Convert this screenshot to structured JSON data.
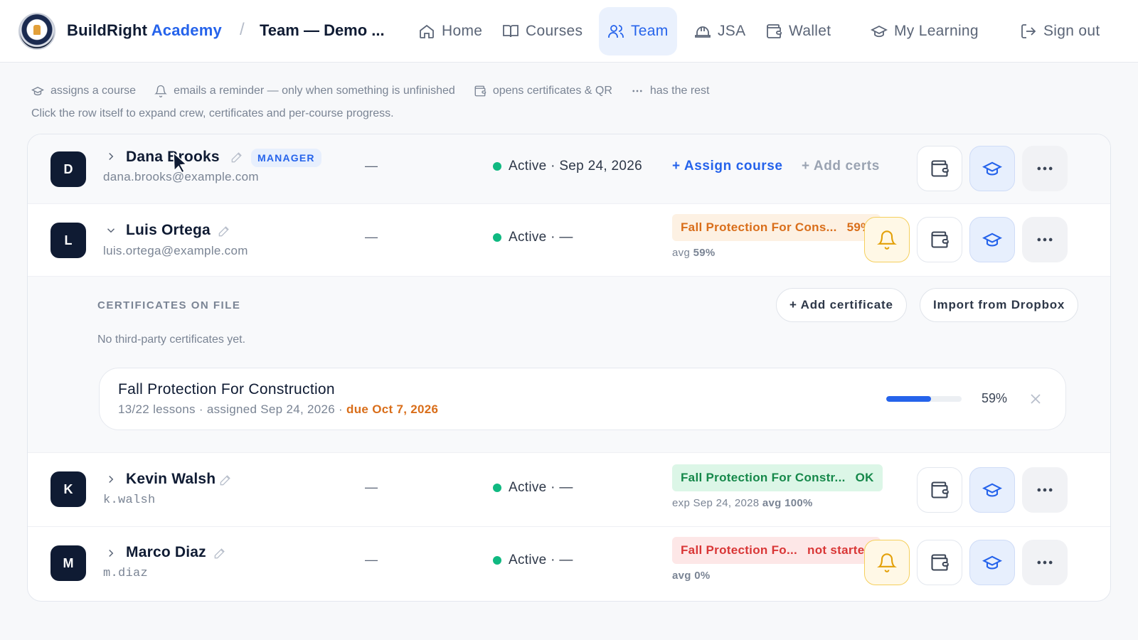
{
  "header": {
    "brand_main": "BuildRight",
    "brand_accent": "Academy",
    "breadcrumb_sep": "/",
    "breadcrumb": "Team — Demo ...",
    "nav": [
      {
        "label": "Home",
        "icon": "home-icon"
      },
      {
        "label": "Courses",
        "icon": "book-icon"
      },
      {
        "label": "Team",
        "icon": "users-icon",
        "active": true
      },
      {
        "label": "JSA",
        "icon": "hardhat-icon"
      },
      {
        "label": "Wallet",
        "icon": "wallet-icon"
      },
      {
        "label": "My Learning",
        "icon": "graduation-cap-icon"
      },
      {
        "label": "Sign out",
        "icon": "sign-out-icon"
      }
    ]
  },
  "hints": {
    "assign": "assigns a course",
    "remind": "emails a reminder — only when something is unfinished",
    "certs": "opens certificates & QR",
    "more": "has the rest",
    "sub": "Click the row itself to expand crew, certificates and per-course progress."
  },
  "members": [
    {
      "initial": "D",
      "name": "Dana Brooks",
      "role_badge": "MANAGER",
      "email": "dana.brooks@example.com",
      "dash": "—",
      "status": "Active · Sep 24, 2026",
      "assign_label": "+ Assign course",
      "addcerts_label": "+ Add certs"
    },
    {
      "initial": "L",
      "name": "Luis Ortega",
      "email": "luis.ortega@example.com",
      "dash": "—",
      "status": "Active · —",
      "course_pill": "Fall Protection For Cons...",
      "course_pill_value": "59%",
      "subline_prefix": "avg",
      "subline_value": "59%",
      "expanded": {
        "cert_heading": "CERTIFICATES ON FILE",
        "add_certificate": "+ Add certificate",
        "import_dropbox": "Import from Dropbox",
        "no_certs": "No third-party certificates yet.",
        "course": {
          "title": "Fall Protection For Construction",
          "meta": "13/22 lessons · assigned Sep 24, 2026 · ",
          "due": "due Oct 7, 2026",
          "progress": 0.59,
          "progress_label": "59%"
        }
      }
    },
    {
      "initial": "K",
      "name": "Kevin Walsh",
      "email": "k.walsh",
      "dash": "—",
      "status": "Active · —",
      "course_pill": "Fall Protection For Constr...",
      "course_pill_value": "OK",
      "subline_exp": "exp Sep 24, 2028",
      "subline_prefix": "avg",
      "subline_value": "100%"
    },
    {
      "initial": "M",
      "name": "Marco Diaz",
      "email": "m.diaz",
      "dash": "—",
      "status": "Active · —",
      "course_pill": "Fall Protection Fo...",
      "course_pill_value": "not started",
      "subline_prefix": "avg",
      "subline_value": "0%"
    }
  ],
  "colors": {
    "accent": "#2563eb",
    "navy": "#0f1b33",
    "status_active": "#10b981",
    "warn": "#d96e1a",
    "ok": "#15884a",
    "bad": "#d93636"
  }
}
